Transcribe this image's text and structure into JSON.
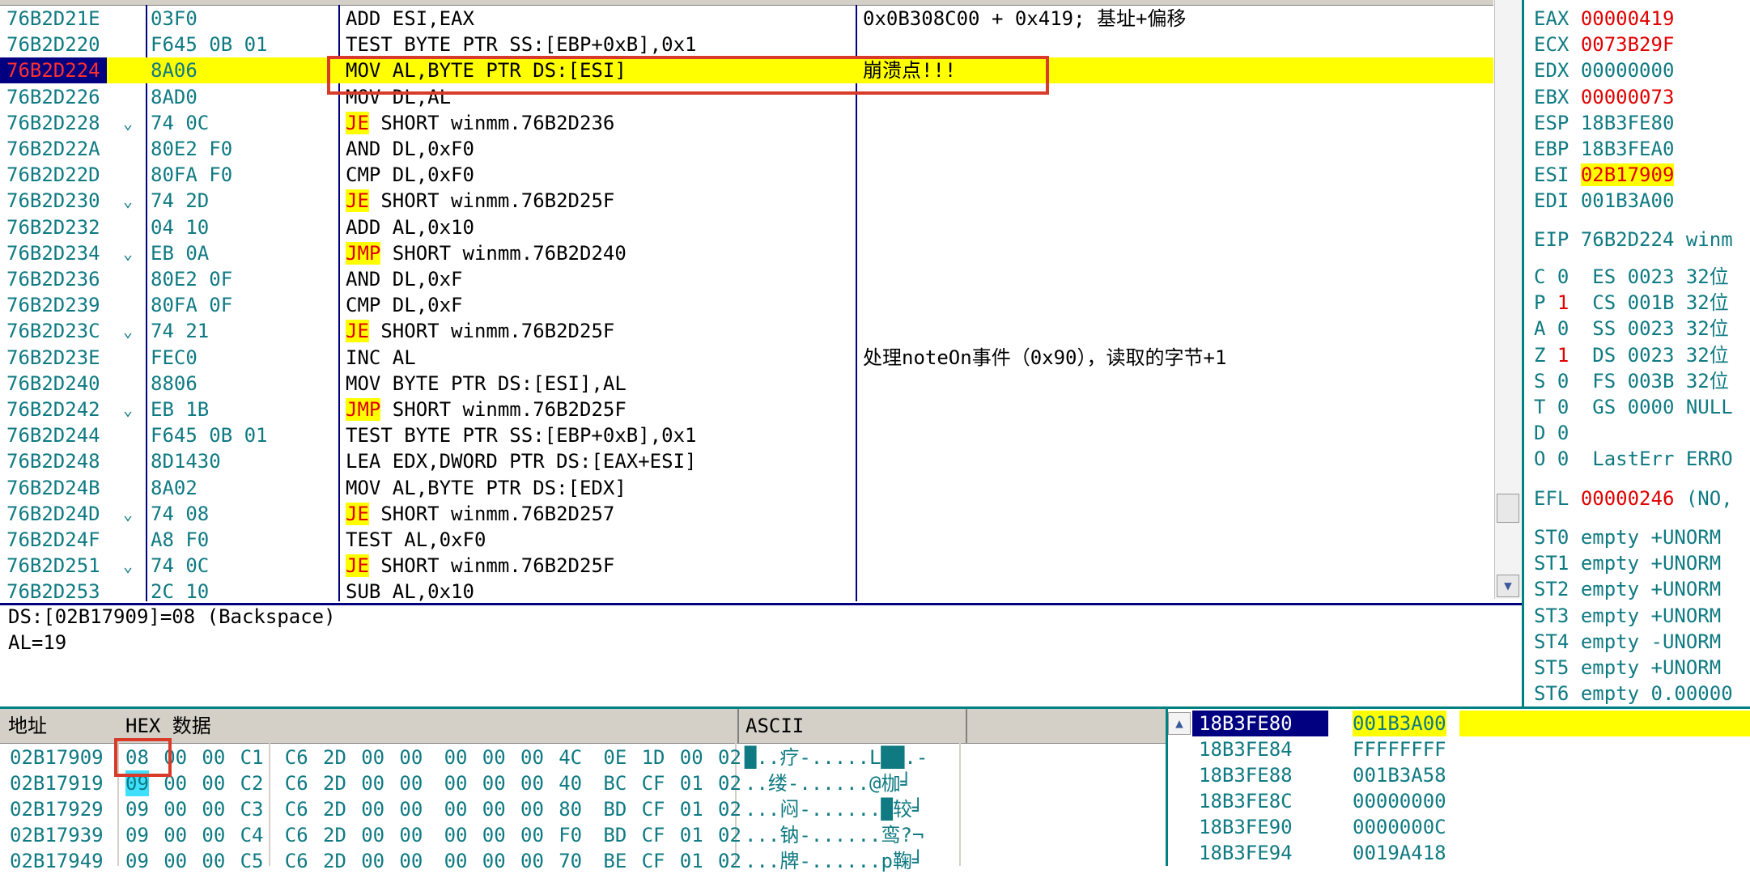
{
  "disasm": {
    "rows": [
      {
        "addr": "76B2D21E",
        "jmp": "",
        "hex": "03F0",
        "m": "",
        "ops": "ADD ESI,EAX",
        "cmt": "0x0B308C00 + 0x419; 基址+偏移"
      },
      {
        "addr": "76B2D220",
        "jmp": "",
        "hex": "F645 0B 01",
        "m": "",
        "ops": "TEST BYTE PTR SS:[EBP+0xB],0x1",
        "cmt": ""
      },
      {
        "addr": "76B2D224",
        "jmp": "",
        "hex": "8A06",
        "m": "",
        "ops": "MOV AL,BYTE PTR DS:[ESI]",
        "cmt": "崩溃点!!!"
      },
      {
        "addr": "76B2D226",
        "jmp": "",
        "hex": "8AD0",
        "m": "",
        "ops": "MOV DL,AL",
        "cmt": ""
      },
      {
        "addr": "76B2D228",
        "jmp": "⌄",
        "hex": "74 0C",
        "m": "JE",
        "ops": " SHORT winmm.76B2D236",
        "cmt": ""
      },
      {
        "addr": "76B2D22A",
        "jmp": "",
        "hex": "80E2 F0",
        "m": "",
        "ops": "AND DL,0xF0",
        "cmt": ""
      },
      {
        "addr": "76B2D22D",
        "jmp": "",
        "hex": "80FA F0",
        "m": "",
        "ops": "CMP DL,0xF0",
        "cmt": ""
      },
      {
        "addr": "76B2D230",
        "jmp": "⌄",
        "hex": "74 2D",
        "m": "JE",
        "ops": " SHORT winmm.76B2D25F",
        "cmt": ""
      },
      {
        "addr": "76B2D232",
        "jmp": "",
        "hex": "04 10",
        "m": "",
        "ops": "ADD AL,0x10",
        "cmt": ""
      },
      {
        "addr": "76B2D234",
        "jmp": "⌄",
        "hex": "EB 0A",
        "m": "JMP",
        "ops": " SHORT winmm.76B2D240",
        "cmt": ""
      },
      {
        "addr": "76B2D236",
        "jmp": "",
        "hex": "80E2 0F",
        "m": "",
        "ops": "AND DL,0xF",
        "cmt": ""
      },
      {
        "addr": "76B2D239",
        "jmp": "",
        "hex": "80FA 0F",
        "m": "",
        "ops": "CMP DL,0xF",
        "cmt": ""
      },
      {
        "addr": "76B2D23C",
        "jmp": "⌄",
        "hex": "74 21",
        "m": "JE",
        "ops": " SHORT winmm.76B2D25F",
        "cmt": ""
      },
      {
        "addr": "76B2D23E",
        "jmp": "",
        "hex": "FEC0",
        "m": "",
        "ops": "INC AL",
        "cmt": "处理noteOn事件（0x90），读取的字节+1"
      },
      {
        "addr": "76B2D240",
        "jmp": "",
        "hex": "8806",
        "m": "",
        "ops": "MOV BYTE PTR DS:[ESI],AL",
        "cmt": ""
      },
      {
        "addr": "76B2D242",
        "jmp": "⌄",
        "hex": "EB 1B",
        "m": "JMP",
        "ops": " SHORT winmm.76B2D25F",
        "cmt": ""
      },
      {
        "addr": "76B2D244",
        "jmp": "",
        "hex": "F645 0B 01",
        "m": "",
        "ops": "TEST BYTE PTR SS:[EBP+0xB],0x1",
        "cmt": ""
      },
      {
        "addr": "76B2D248",
        "jmp": "",
        "hex": "8D1430",
        "m": "",
        "ops": "LEA EDX,DWORD PTR DS:[EAX+ESI]",
        "cmt": ""
      },
      {
        "addr": "76B2D24B",
        "jmp": "",
        "hex": "8A02",
        "m": "",
        "ops": "MOV AL,BYTE PTR DS:[EDX]",
        "cmt": ""
      },
      {
        "addr": "76B2D24D",
        "jmp": "⌄",
        "hex": "74 08",
        "m": "JE",
        "ops": " SHORT winmm.76B2D257",
        "cmt": ""
      },
      {
        "addr": "76B2D24F",
        "jmp": "",
        "hex": "A8 F0",
        "m": "",
        "ops": "TEST AL,0xF0",
        "cmt": ""
      },
      {
        "addr": "76B2D251",
        "jmp": "⌄",
        "hex": "74 0C",
        "m": "JE",
        "ops": " SHORT winmm.76B2D25F",
        "cmt": ""
      },
      {
        "addr": "76B2D253",
        "jmp": "",
        "hex": "2C 10",
        "m": "",
        "ops": "SUB AL,0x10",
        "cmt": ""
      }
    ]
  },
  "info": {
    "line1": "DS:[02B17909]=08 (Backspace)",
    "line2": "AL=19"
  },
  "regs": {
    "gp": [
      {
        "n": "EAX",
        "v": "00000419",
        "s": "chg"
      },
      {
        "n": "ECX",
        "v": "0073B29F",
        "s": "chg"
      },
      {
        "n": "EDX",
        "v": "00000000",
        "s": ""
      },
      {
        "n": "EBX",
        "v": "00000073",
        "s": "chg"
      },
      {
        "n": "ESP",
        "v": "18B3FE80",
        "s": ""
      },
      {
        "n": "EBP",
        "v": "18B3FEA0",
        "s": ""
      },
      {
        "n": "ESI",
        "v": "02B17909",
        "s": "esihl"
      },
      {
        "n": "EDI",
        "v": "001B3A00",
        "s": ""
      }
    ],
    "eip": {
      "n": "EIP",
      "v": "76B2D224 winm"
    },
    "flags": [
      {
        "f": "C",
        "b": "0",
        "seg": "ES 0023 32位"
      },
      {
        "f": "P",
        "b": "1",
        "seg": "CS 001B 32位"
      },
      {
        "f": "A",
        "b": "0",
        "seg": "SS 0023 32位"
      },
      {
        "f": "Z",
        "b": "1",
        "seg": "DS 0023 32位"
      },
      {
        "f": "S",
        "b": "0",
        "seg": "FS 003B 32位"
      },
      {
        "f": "T",
        "b": "0",
        "seg": "GS 0000 NULL"
      },
      {
        "f": "D",
        "b": "0",
        "seg": ""
      },
      {
        "f": "O",
        "b": "0",
        "seg": "LastErr ERRO"
      }
    ],
    "efl": {
      "n": "EFL",
      "v": "00000246",
      "rest": " (NO,"
    },
    "fpu": [
      {
        "n": "ST0",
        "v": "empty +UNORM"
      },
      {
        "n": "ST1",
        "v": "empty +UNORM"
      },
      {
        "n": "ST2",
        "v": "empty +UNORM"
      },
      {
        "n": "ST3",
        "v": "empty +UNORM"
      },
      {
        "n": "ST4",
        "v": "empty -UNORM"
      },
      {
        "n": "ST5",
        "v": "empty +UNORM"
      },
      {
        "n": "ST6",
        "v": "empty 0.00000"
      }
    ]
  },
  "dump": {
    "col_addr": "地址",
    "col_hex": "HEX 数据",
    "col_ascii": "ASCII",
    "rows": [
      {
        "a": "02B17909",
        "b": [
          "08",
          "00",
          "00",
          "C1",
          "C6",
          "2D",
          "00",
          "00",
          "00",
          "00",
          "00",
          "4C",
          "0E",
          "1D",
          "00",
          "02"
        ],
        "t": "█..疗-.....L██.-"
      },
      {
        "a": "02B17919",
        "b": [
          "09",
          "00",
          "00",
          "C2",
          "C6",
          "2D",
          "00",
          "00",
          "00",
          "00",
          "00",
          "40",
          "BC",
          "CF",
          "01",
          "02"
        ],
        "t": "..缕-......@枷╛"
      },
      {
        "a": "02B17929",
        "b": [
          "09",
          "00",
          "00",
          "C3",
          "C6",
          "2D",
          "00",
          "00",
          "00",
          "00",
          "00",
          "80",
          "BD",
          "CF",
          "01",
          "02"
        ],
        "t": "...闷-......█较╛"
      },
      {
        "a": "02B17939",
        "b": [
          "09",
          "00",
          "00",
          "C4",
          "C6",
          "2D",
          "00",
          "00",
          "00",
          "00",
          "00",
          "F0",
          "BD",
          "CF",
          "01",
          "02"
        ],
        "t": "...钠-......鸾?¬"
      },
      {
        "a": "02B17949",
        "b": [
          "09",
          "00",
          "00",
          "C5",
          "C6",
          "2D",
          "00",
          "00",
          "00",
          "00",
          "00",
          "70",
          "BE",
          "CF",
          "01",
          "02"
        ],
        "t": "...牌-......p鞠╛"
      }
    ]
  },
  "stack": {
    "rows": [
      {
        "a": "18B3FE80",
        "v": "001B3A00"
      },
      {
        "a": "18B3FE84",
        "v": "FFFFFFFF"
      },
      {
        "a": "18B3FE88",
        "v": "001B3A58"
      },
      {
        "a": "18B3FE8C",
        "v": "00000000"
      },
      {
        "a": "18B3FE90",
        "v": "0000000C"
      },
      {
        "a": "18B3FE94",
        "v": "0019A418"
      }
    ]
  },
  "colors": {
    "highlight": "#ffff00",
    "selection": "#000080",
    "changed": "#e00000",
    "address": "#0f7a82",
    "box": "#d83b2a"
  }
}
